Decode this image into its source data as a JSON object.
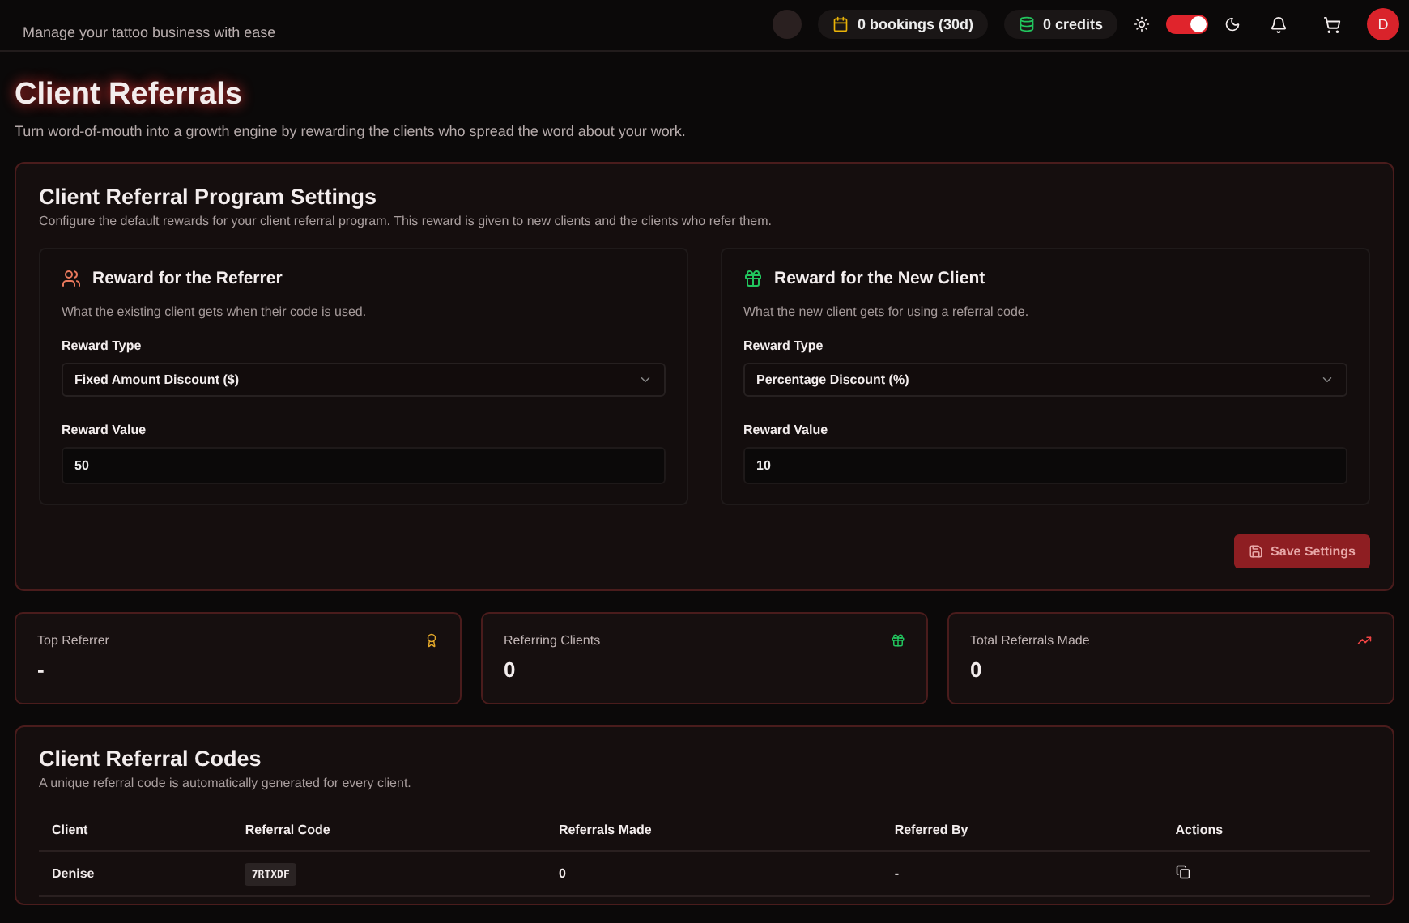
{
  "header": {
    "subtitle": "Manage your tattoo business with ease",
    "bookings": "0 bookings (30d)",
    "credits": "0 credits",
    "theme_toggle": {
      "on": true
    },
    "avatar": "D"
  },
  "page": {
    "title": "Client Referrals",
    "subtitle": "Turn word-of-mouth into a growth engine by rewarding the clients who spread the word about your work."
  },
  "settings": {
    "title": "Client Referral Program Settings",
    "description": "Configure the default rewards for your client referral program. This reward is given to new clients and the clients who refer them.",
    "panels": [
      {
        "kind": "referrer",
        "title": "Reward for the Referrer",
        "description": "What the existing client gets when their code is used.",
        "type_label": "Reward Type",
        "type_value": "Fixed Amount Discount ($)",
        "value_label": "Reward Value",
        "value": "50"
      },
      {
        "kind": "new_client",
        "title": "Reward for the New Client",
        "description": "What the new client gets for using a referral code.",
        "type_label": "Reward Type",
        "type_value": "Percentage Discount (%)",
        "value_label": "Reward Value",
        "value": "10"
      }
    ],
    "save_button": {
      "label": "Save Settings",
      "disabled": true
    }
  },
  "stats": [
    {
      "kind": "award",
      "label": "Top Referrer",
      "value": "-"
    },
    {
      "kind": "gift",
      "label": "Referring Clients",
      "value": "0"
    },
    {
      "kind": "trend",
      "label": "Total Referrals Made",
      "value": "0"
    }
  ],
  "codes": {
    "title": "Client Referral Codes",
    "description": "A unique referral code is automatically generated for every client.",
    "columns": [
      "Client",
      "Referral Code",
      "Referrals Made",
      "Referred By",
      "Actions"
    ],
    "rows": [
      {
        "client": "Denise",
        "code": "7RTXDF",
        "referrals": "0",
        "referred_by": "-"
      }
    ]
  }
}
